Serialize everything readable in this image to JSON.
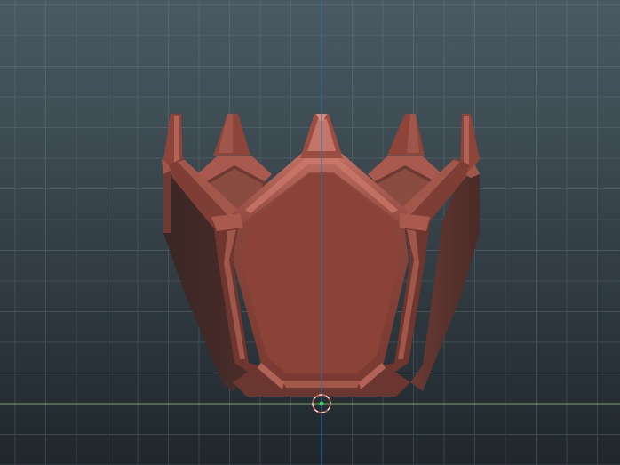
{
  "viewport": {
    "view": "front",
    "background_top": "#4a5a63",
    "background_bottom": "#1f272c",
    "grid_color": "#7a8a94",
    "x_axis_color": "#7fa844",
    "z_axis_color": "#2f6fb0"
  },
  "model": {
    "name": "crown-pot",
    "base_color": "#8b4338",
    "highlight_color": "#b8695c",
    "shadow_color": "#3f2825"
  },
  "pivot": {
    "ring_color": "#e8e8e8",
    "dash_color": "#d64a3a",
    "center_color": "#3ccf6a"
  }
}
